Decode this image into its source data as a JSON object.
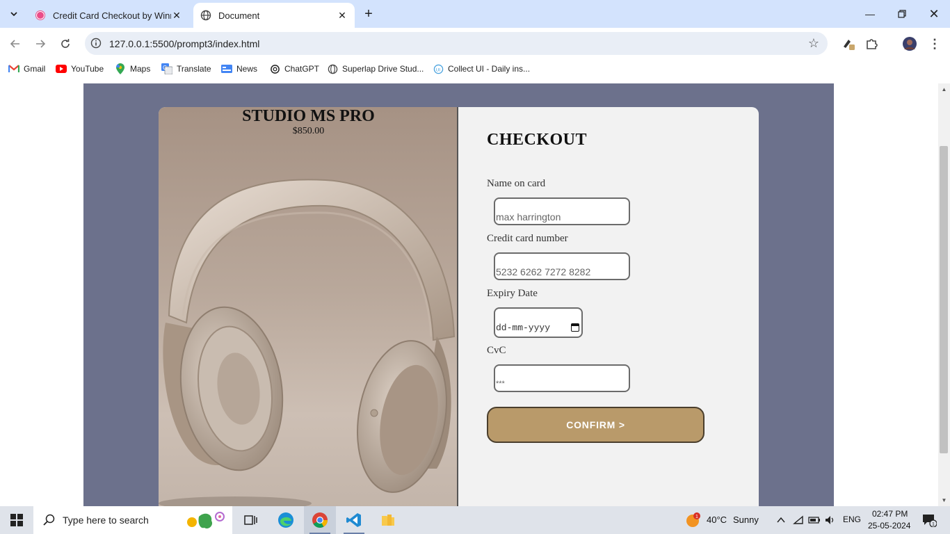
{
  "browser": {
    "tabs": [
      {
        "title": "Credit Card Checkout by Winnie",
        "active": false
      },
      {
        "title": "Document",
        "active": true
      }
    ],
    "url": "127.0.0.1:5500/prompt3/index.html",
    "bookmarks": [
      {
        "label": "Gmail",
        "icon": "gmail-icon"
      },
      {
        "label": "YouTube",
        "icon": "youtube-icon"
      },
      {
        "label": "Maps",
        "icon": "maps-icon"
      },
      {
        "label": "Translate",
        "icon": "translate-icon"
      },
      {
        "label": "News",
        "icon": "news-icon"
      },
      {
        "label": "ChatGPT",
        "icon": "chatgpt-icon"
      },
      {
        "label": "Superlap Drive Stud...",
        "icon": "globe-icon"
      },
      {
        "label": "Collect UI - Daily ins...",
        "icon": "collectui-icon"
      }
    ]
  },
  "product": {
    "name": "STUDIO MS PRO",
    "price": "$850.00"
  },
  "checkout": {
    "title": "CHECKOUT",
    "name_label": "Name on card",
    "name_value": "max harrington",
    "card_label": "Credit card number",
    "card_value": "5232 6262 7272 8282",
    "expiry_label": "Expiry Date",
    "expiry_value": "dd-mm-yyyy",
    "cvc_label": "CvC",
    "cvc_value": "***",
    "confirm_label": "CONFIRM >"
  },
  "colors": {
    "page_background": "#6c718c",
    "confirm_button": "#b99a6a",
    "card_background": "#f2f2f2"
  },
  "taskbar": {
    "search_placeholder": "Type here to search",
    "weather_temp": "40°C",
    "weather_desc": "Sunny",
    "language": "ENG",
    "time": "02:47 PM",
    "date": "25-05-2024",
    "weather_badge": "1",
    "notification_count": "1"
  }
}
